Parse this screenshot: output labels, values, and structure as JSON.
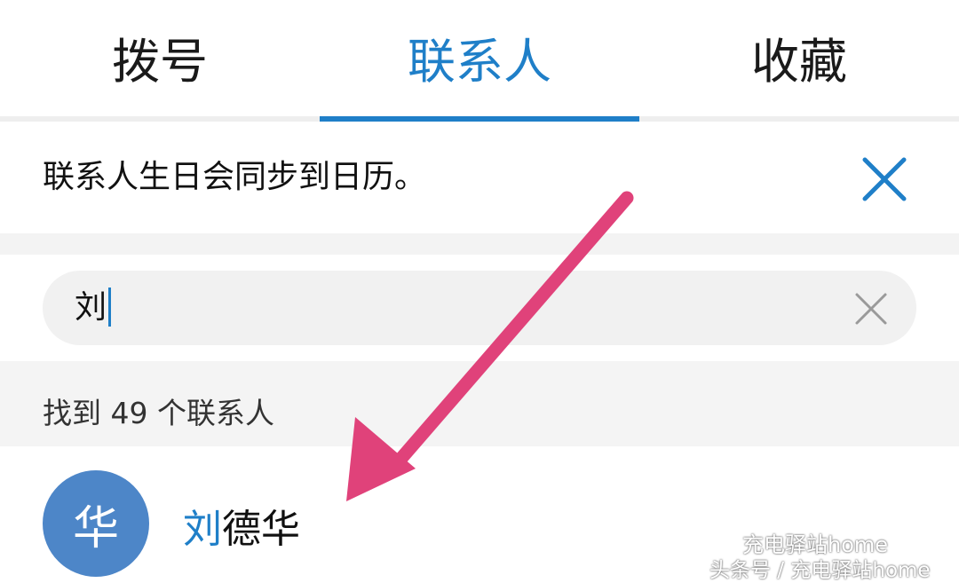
{
  "tabs": [
    {
      "label": "拨号"
    },
    {
      "label": "联系人"
    },
    {
      "label": "收藏"
    }
  ],
  "active_tab": "联系人",
  "accent_color": "#1f7fc8",
  "notice": {
    "text": "联系人生日会同步到日历。",
    "close_icon": "close-icon"
  },
  "search": {
    "value": "刘",
    "clear_icon": "clear-icon"
  },
  "results": {
    "summary": "找到 49 个联系人"
  },
  "contact": {
    "avatar_text": "华",
    "name_highlight": "刘",
    "name_rest": "德华"
  },
  "annotation": {
    "arrow_color": "#e0427a"
  },
  "watermark": {
    "line1": "充电驿站home",
    "line2": "头条号 / 充电驿站home"
  }
}
